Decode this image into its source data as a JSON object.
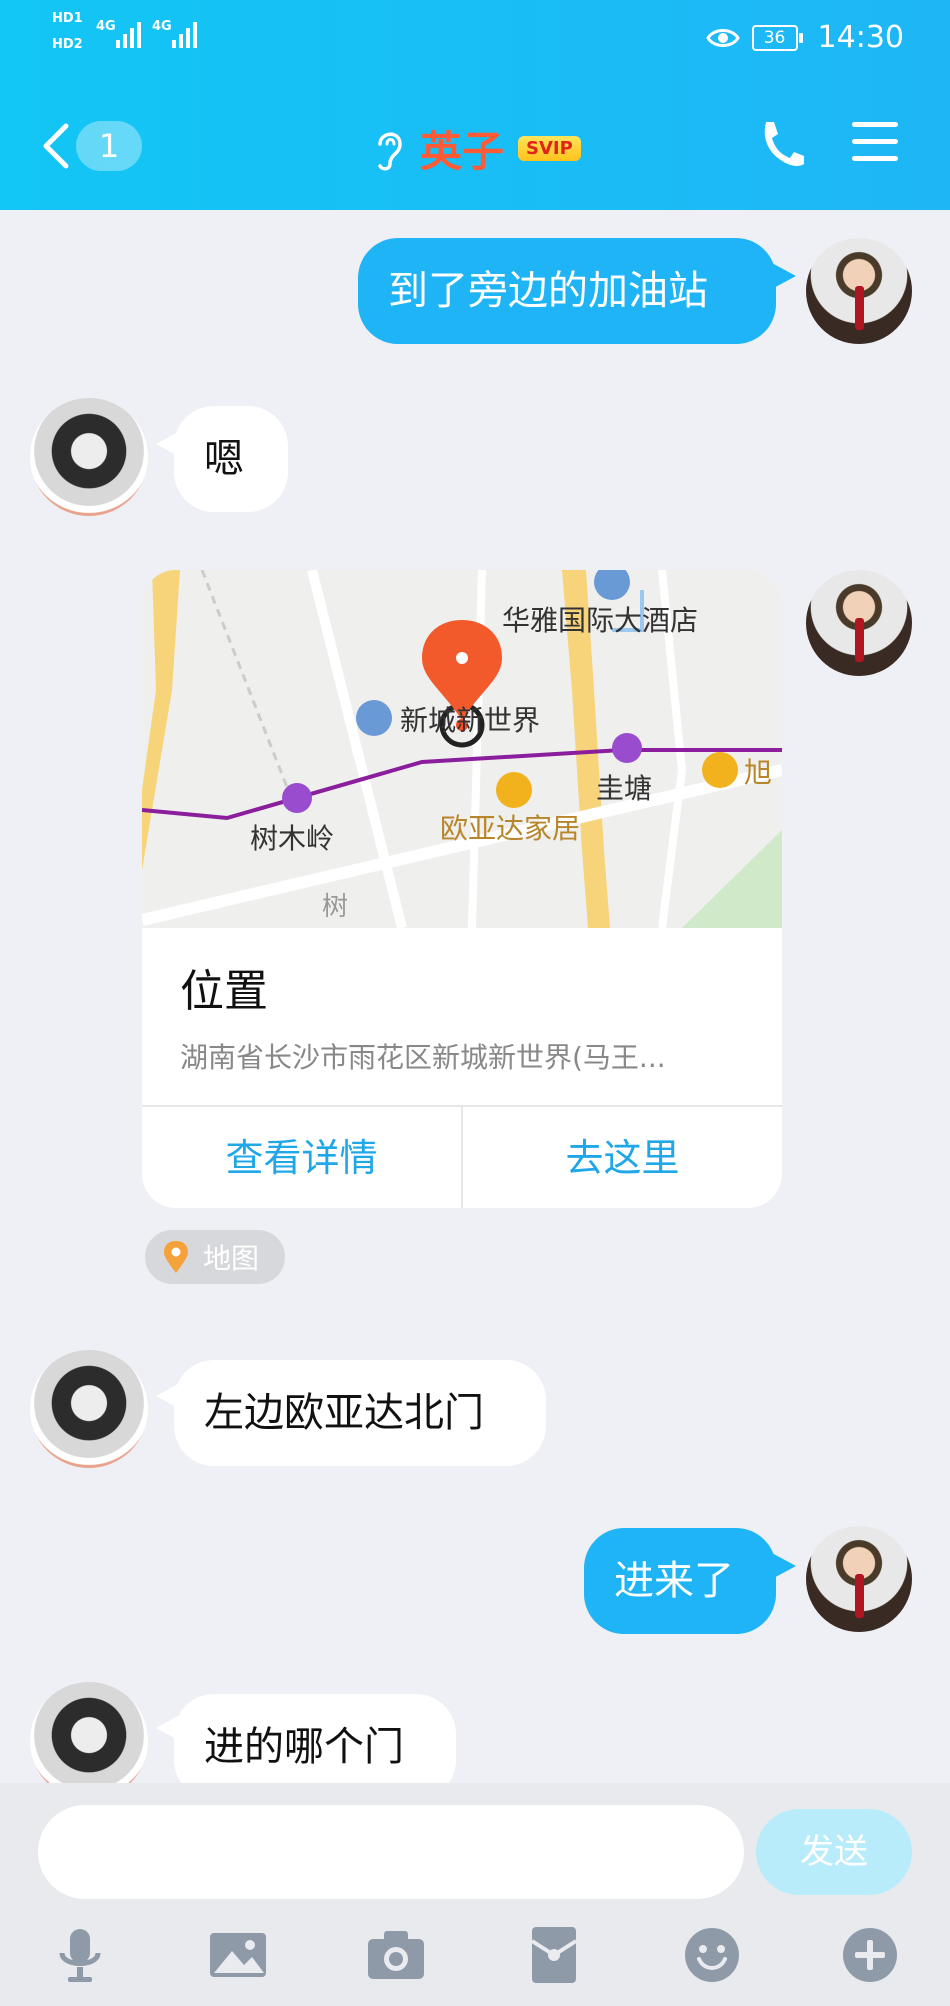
{
  "status_bar": {
    "sim1_label": "HD1",
    "sim2_label": "HD2",
    "net1": "4G",
    "net2": "4G",
    "battery": "36",
    "time": "14:30"
  },
  "header": {
    "unread_count": "1",
    "contact_name": "英子",
    "vip_badge": "SVIP"
  },
  "messages": [
    {
      "side": "out",
      "text": "到了旁边的加油站"
    },
    {
      "side": "in",
      "text": "嗯"
    },
    {
      "side": "out",
      "type": "location"
    },
    {
      "side": "in",
      "text": "左边欧亚达北门"
    },
    {
      "side": "out",
      "text": "进来了"
    },
    {
      "side": "in",
      "text": "进的哪个门"
    }
  ],
  "location_card": {
    "map_labels": {
      "hotel": "华雅国际大酒店",
      "place": "新城新世界",
      "station1": "圭塘",
      "station2": "树木岭",
      "mall": "欧亚达家居",
      "edge": "旭",
      "road": "树"
    },
    "title": "位置",
    "address": "湖南省长沙市雨花区新城新世界(马王...",
    "action_details": "查看详情",
    "action_go": "去这里",
    "source_tag": "地图"
  },
  "input": {
    "placeholder": "",
    "send_label": "发送"
  },
  "toolbar": {
    "tools": [
      "mic-icon",
      "image-icon",
      "camera-icon",
      "red-packet-icon",
      "emoji-icon",
      "plus-icon"
    ]
  },
  "colors": {
    "header": "#1fb6f6",
    "bubble_out": "#1fb4f5",
    "name": "#ff5a36",
    "link": "#1fa7e8"
  }
}
